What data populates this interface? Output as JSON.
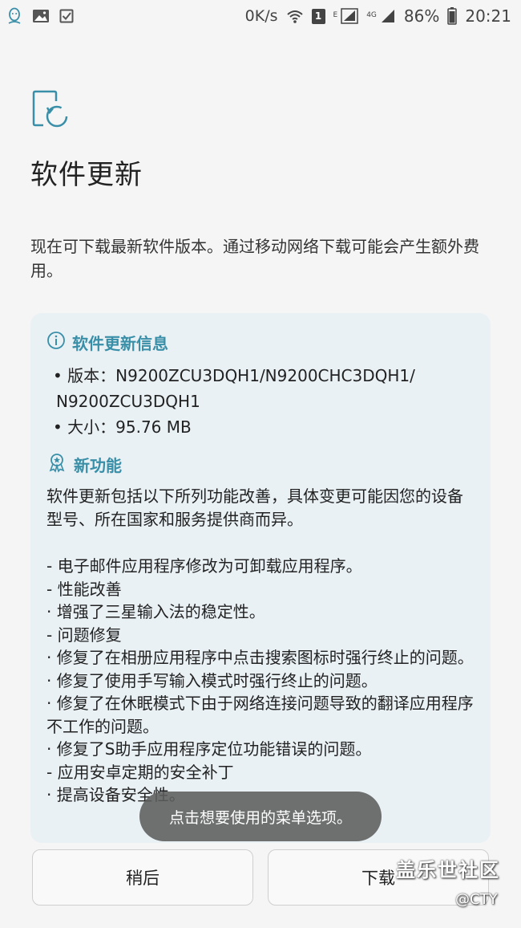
{
  "status_bar": {
    "net_speed": "0K/s",
    "sim_badge": "1",
    "e_label": "E",
    "lte_label": "4G",
    "battery": "86%",
    "time": "20:21",
    "icons": [
      "qq-icon",
      "image-icon",
      "checkbox-icon",
      "wifi-icon",
      "signal-icon",
      "battery-icon"
    ]
  },
  "page": {
    "title": "软件更新",
    "intro": "现在可下载最新软件版本。通过移动网络下载可能会产生额外费用。"
  },
  "info_card": {
    "section_title": "软件更新信息",
    "version_line1": "• 版本：N9200ZCU3DQH1/N9200CHC3DQH1/",
    "version_line2": "N9200ZCU3DQH1",
    "size_line": "• 大小：95.76 MB",
    "features_title": "新功能",
    "features_desc": "软件更新包括以下所列功能改善，具体变更可能因您的设备型号、所在国家和服务提供商而异。",
    "changes": [
      "- 电子邮件应用程序修改为可卸载应用程序。",
      "- 性能改善",
      " · 增强了三星输入法的稳定性。",
      "- 问题修复",
      " · 修复了在相册应用程序中点击搜索图标时强行终止的问题。",
      " · 修复了使用手写输入模式时强行终止的问题。",
      " · 修复了在休眠模式下由于网络连接问题导致的翻译应用程序不工作的问题。",
      " · 修复了S助手应用程序定位功能错误的问题。",
      "- 应用安卓定期的安全补丁",
      " · 提高设备安全性。"
    ]
  },
  "toast": {
    "text": "点击想要使用的菜单选项。"
  },
  "buttons": {
    "later": "稍后",
    "download": "下载"
  },
  "watermark": {
    "main": "盖乐世社区",
    "sub": "@CTY"
  },
  "colors": {
    "accent": "#3a8fa8",
    "card_bg": "#e9f1f5",
    "page_bg": "#f5f5f5"
  }
}
